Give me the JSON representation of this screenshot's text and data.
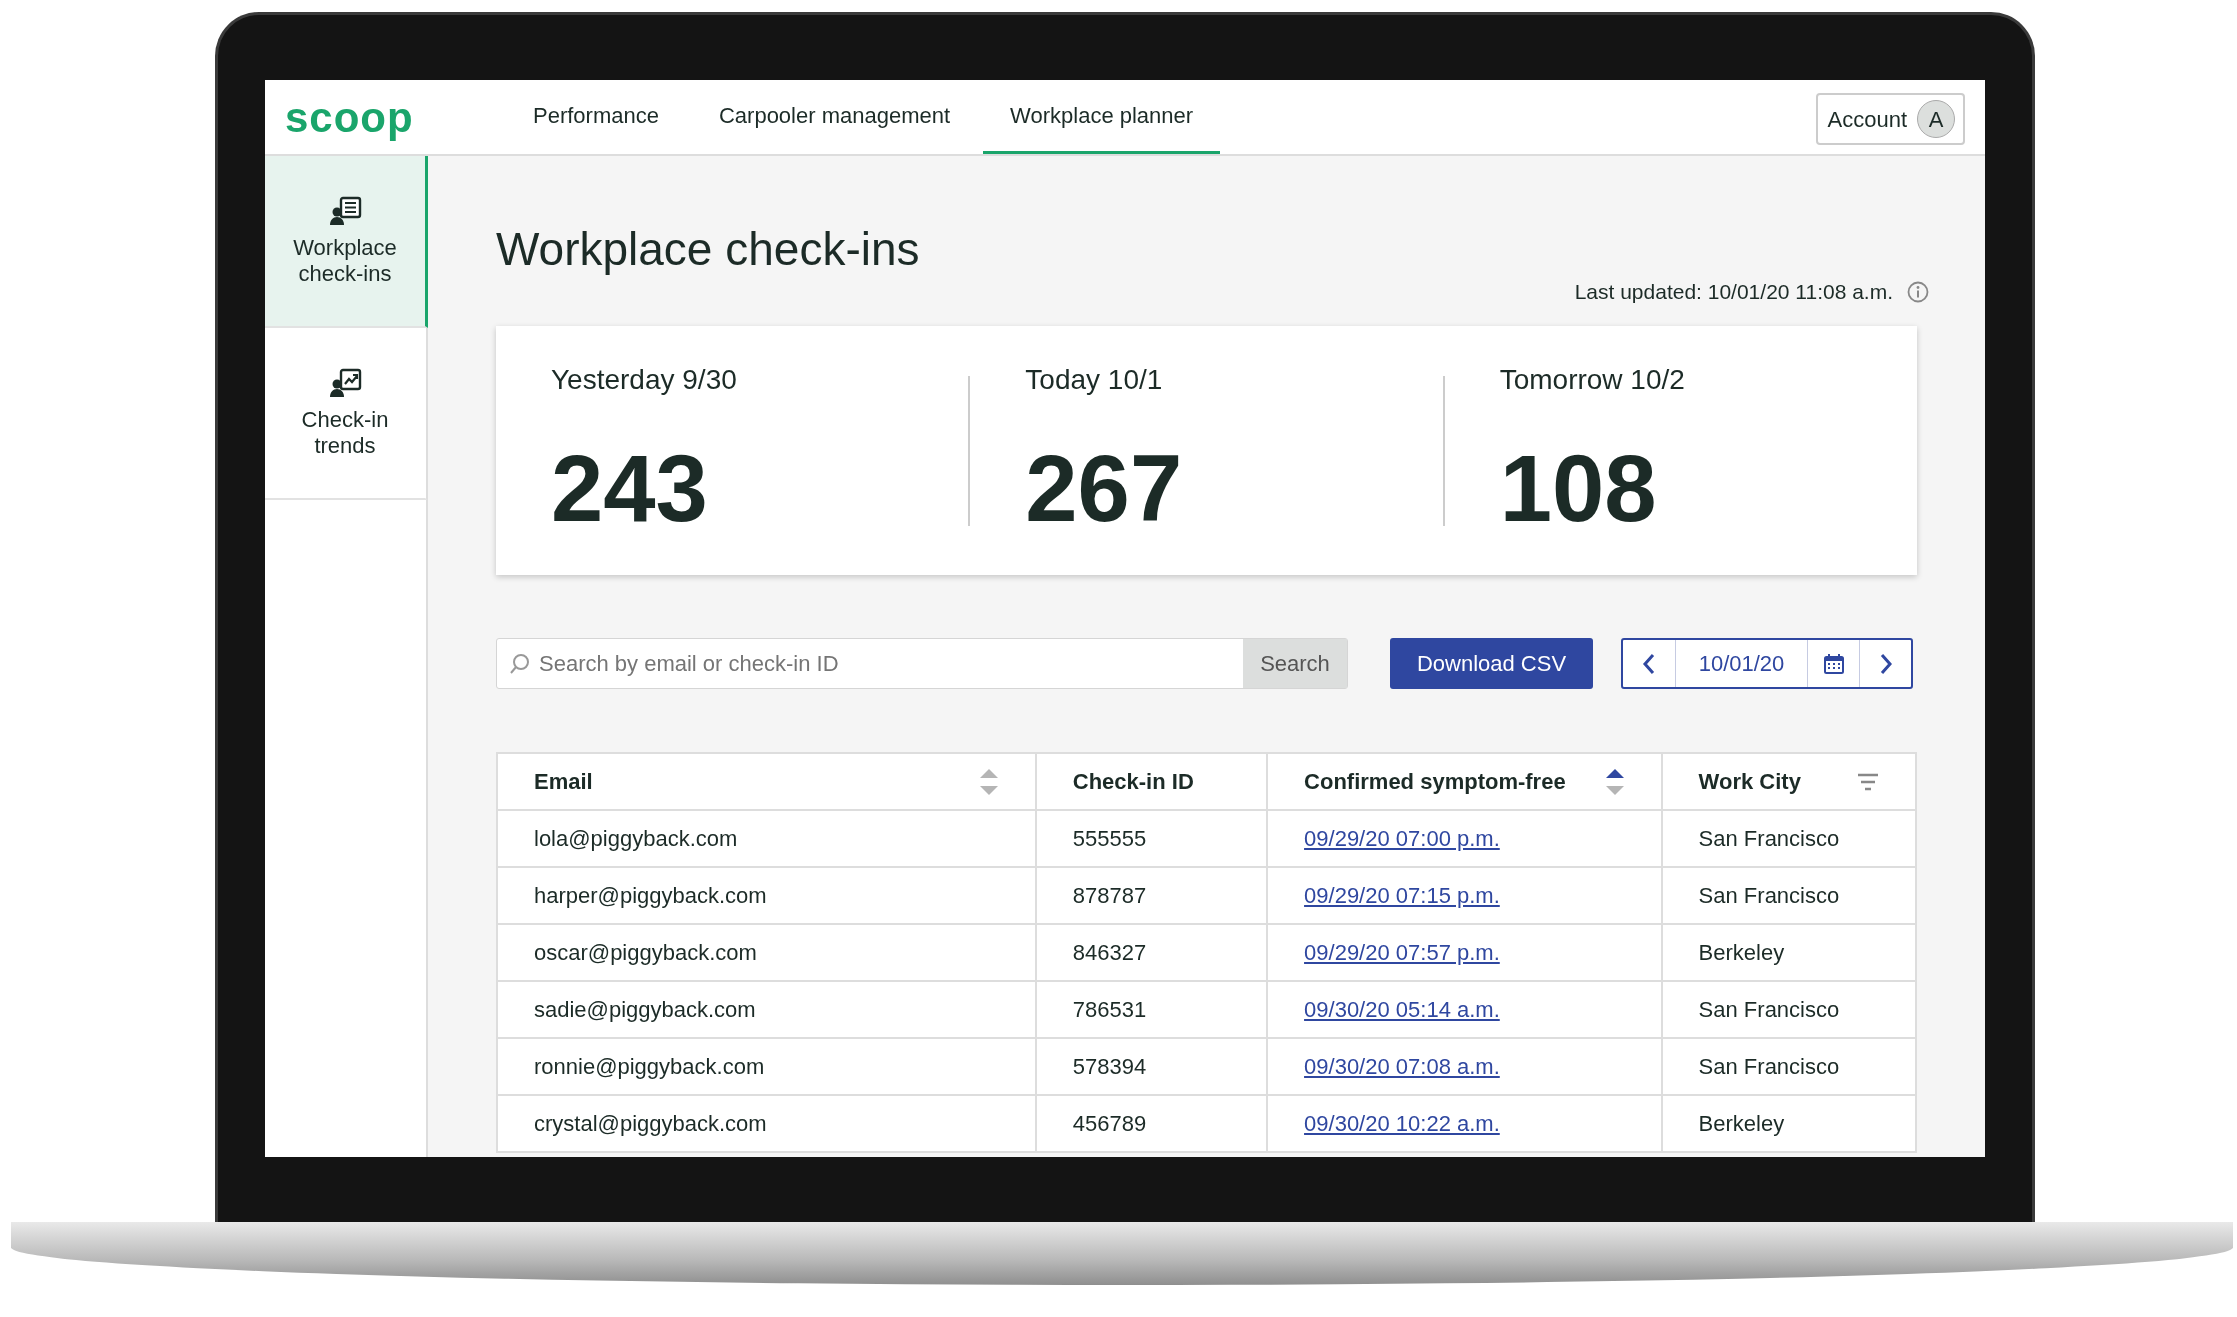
{
  "logo": "scoop",
  "nav": [
    {
      "label": "Performance",
      "selected": false
    },
    {
      "label": "Carpooler management",
      "selected": false
    },
    {
      "label": "Workplace planner",
      "selected": true
    }
  ],
  "account": {
    "label": "Account",
    "initial": "A"
  },
  "sidebar": {
    "items": [
      {
        "label": "Workplace check-ins",
        "kind": "list",
        "selected": true
      },
      {
        "label": "Check-in trends",
        "kind": "chart",
        "selected": false
      }
    ]
  },
  "title": "Workplace check-ins",
  "last_updated": "Last updated: 10/01/20 11:08 a.m.",
  "stats": [
    {
      "label": "Yesterday 9/30",
      "value": "243"
    },
    {
      "label": "Today 10/1",
      "value": "267"
    },
    {
      "label": "Tomorrow 10/2",
      "value": "108"
    }
  ],
  "search": {
    "placeholder": "Search by email or check-in ID",
    "button": "Search"
  },
  "download_button": "Download CSV",
  "date": "10/01/20",
  "table": {
    "columns": [
      {
        "label": "Email",
        "kind": "text",
        "sorted": false
      },
      {
        "label": "Check-in ID",
        "kind": "text"
      },
      {
        "label": "Confirmed symptom-free",
        "kind": "link",
        "sorted": true
      },
      {
        "label": "Work City",
        "kind": "text",
        "filter": true
      }
    ],
    "rows": [
      [
        "lola@piggyback.com",
        "555555",
        "09/29/20 07:00 p.m.",
        "San Francisco"
      ],
      [
        "harper@piggyback.com",
        "878787",
        "09/29/20 07:15 p.m.",
        "San Francisco"
      ],
      [
        "oscar@piggyback.com",
        "846327",
        "09/29/20 07:57 p.m.",
        "Berkeley"
      ],
      [
        "sadie@piggyback.com",
        "786531",
        "09/30/20 05:14 a.m.",
        "San Francisco"
      ],
      [
        "ronnie@piggyback.com",
        "578394",
        "09/30/20 07:08 a.m.",
        "San Francisco"
      ],
      [
        "crystal@piggyback.com",
        "456789",
        "09/30/20 10:22 a.m.",
        "Berkeley"
      ]
    ]
  }
}
